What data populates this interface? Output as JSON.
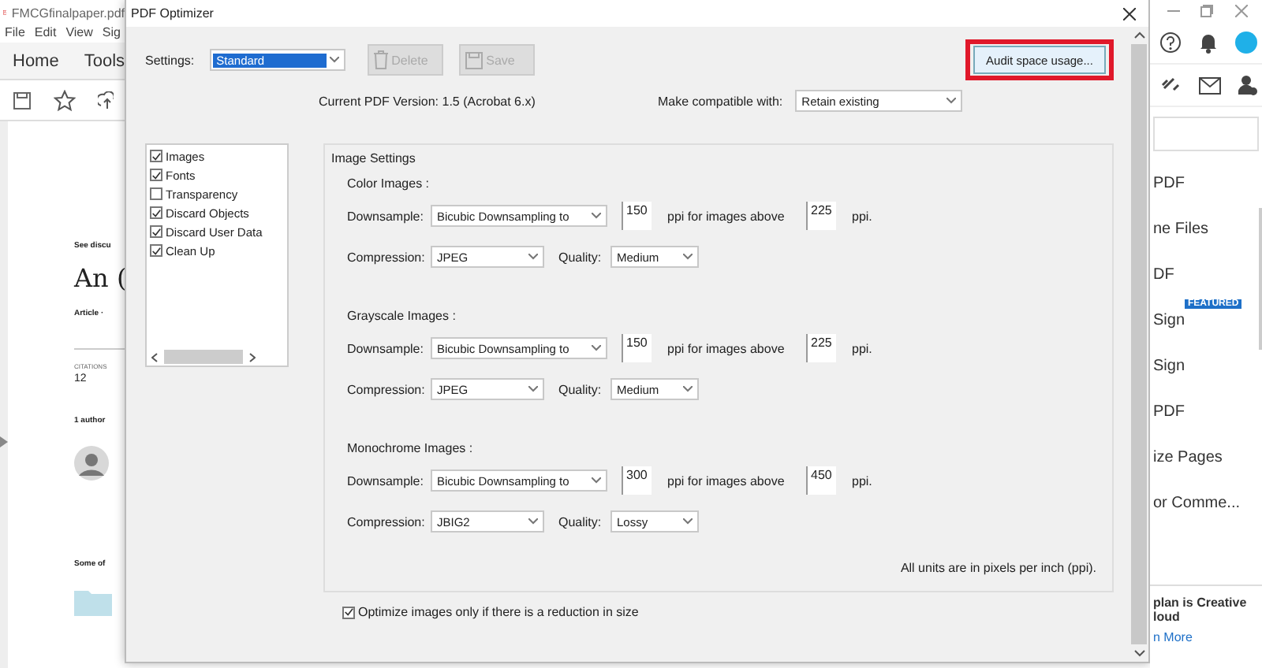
{
  "app": {
    "title": "FMCGfinalpaper.pdf",
    "menu": [
      "File",
      "Edit",
      "View",
      "Sig"
    ],
    "tabs": [
      "Home",
      "Tools"
    ]
  },
  "document": {
    "see": "See discu",
    "heading": "An (",
    "article": "Article ·",
    "citations_label": "CITATIONS",
    "citations": "12",
    "authors": "1 author",
    "some": "Some of"
  },
  "right_panel": {
    "items": [
      {
        "label": "PDF"
      },
      {
        "label": "ne Files"
      },
      {
        "label": "DF"
      },
      {
        "label": "Sign",
        "badge": "FEATURED"
      },
      {
        "label": "Sign"
      },
      {
        "label": "PDF"
      },
      {
        "label": "ize Pages"
      },
      {
        "label": "or Comme..."
      }
    ],
    "plan": "plan is Creative",
    "plan_2": "loud",
    "link": "n More"
  },
  "dialog": {
    "title": "PDF Optimizer",
    "settings_label": "Settings:",
    "settings_value": "Standard",
    "buttons": [
      {
        "label": "Delete",
        "disabled": true,
        "kind": "trash"
      },
      {
        "label": "Save",
        "disabled": true,
        "kind": "disk"
      }
    ],
    "audit": "Audit space usage...",
    "version": "Current PDF Version: 1.5 (Acrobat 6.x)",
    "compat_label": "Make compatible with:",
    "compat_value": "Retain existing",
    "panels": [
      {
        "label": "Images",
        "checked": true
      },
      {
        "label": "Fonts",
        "checked": true
      },
      {
        "label": "Transparency",
        "checked": false
      },
      {
        "label": "Discard Objects",
        "checked": true
      },
      {
        "label": "Discard User Data",
        "checked": true
      },
      {
        "label": "Clean Up",
        "checked": true
      }
    ],
    "group_title": "Image Settings",
    "sections": [
      {
        "title": "Color Images :",
        "downsample_label": "Downsample:",
        "method": "Bicubic Downsampling to",
        "ppi": "150",
        "above_label": "ppi for images above",
        "above": "225",
        "unit": "ppi.",
        "compression_label": "Compression:",
        "compression": "JPEG",
        "quality_label": "Quality:",
        "quality": "Medium"
      },
      {
        "title": "Grayscale Images :",
        "downsample_label": "Downsample:",
        "method": "Bicubic Downsampling to",
        "ppi": "150",
        "above_label": "ppi for images above",
        "above": "225",
        "unit": "ppi.",
        "compression_label": "Compression:",
        "compression": "JPEG",
        "quality_label": "Quality:",
        "quality": "Medium"
      },
      {
        "title": "Monochrome Images :",
        "downsample_label": "Downsample:",
        "method": "Bicubic Downsampling to",
        "ppi": "300",
        "above_label": "ppi for images above",
        "above": "450",
        "unit": "ppi.",
        "compression_label": "Compression:",
        "compression": "JBIG2",
        "quality_label": "Quality:",
        "quality": "Lossy"
      }
    ],
    "note": "All units are in pixels per inch (ppi).",
    "optimize": {
      "label": "Optimize images only if there is a reduction in size",
      "checked": true
    }
  }
}
